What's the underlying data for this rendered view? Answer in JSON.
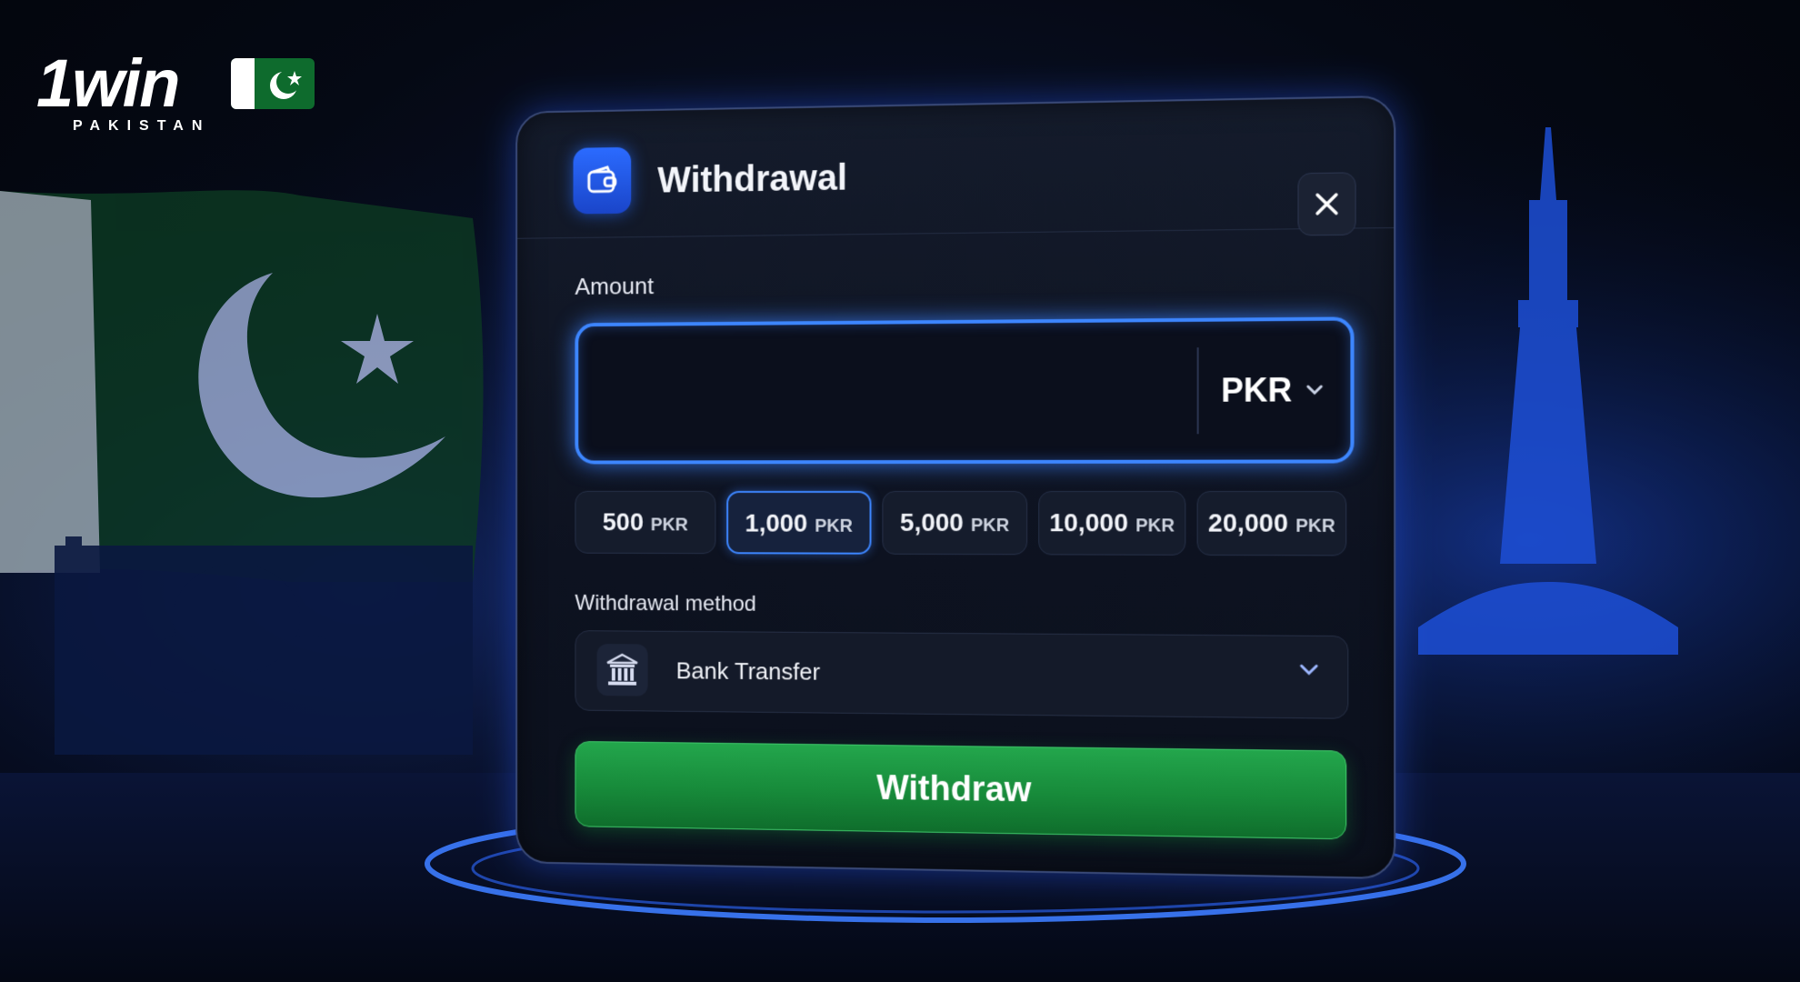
{
  "brand": {
    "logo_text": "1win",
    "logo_subtitle": "PAKISTAN",
    "accent": "#1e6bff",
    "flag_green": "#0e6b2d"
  },
  "dialog": {
    "title": "Withdrawal",
    "icon": "wallet-icon",
    "close_icon": "close-icon"
  },
  "amount": {
    "label": "Amount",
    "value": "",
    "currency": "PKR",
    "currency_icon": "chevron-down-icon",
    "focus_color": "#3d86ff"
  },
  "quick_amounts": [
    {
      "value": "500",
      "currency": "PKR",
      "selected": false
    },
    {
      "value": "1,000",
      "currency": "PKR",
      "selected": true
    },
    {
      "value": "5,000",
      "currency": "PKR",
      "selected": false
    },
    {
      "value": "10,000",
      "currency": "PKR",
      "selected": false
    },
    {
      "value": "20,000",
      "currency": "PKR",
      "selected": false
    }
  ],
  "method": {
    "label": "Withdrawal method",
    "selected": "Bank Transfer",
    "icon": "bank-icon"
  },
  "submit": {
    "label": "Withdraw",
    "color": "#1e9a45"
  }
}
